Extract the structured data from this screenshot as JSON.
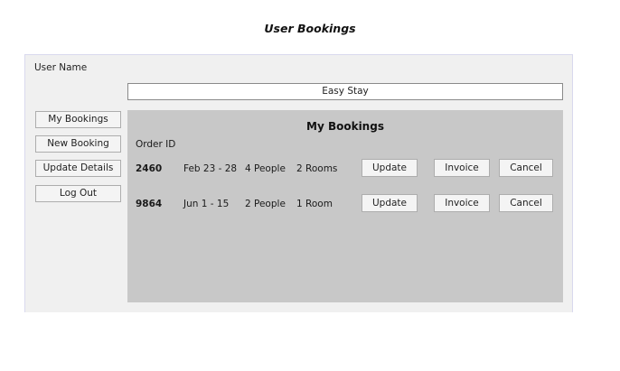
{
  "page": {
    "title": "User Bookings"
  },
  "user": {
    "label": "User Name"
  },
  "hotel": {
    "value": "Easy Stay"
  },
  "nav": {
    "my_bookings": "My Bookings",
    "new_booking": "New Booking",
    "update_details": "Update Details",
    "log_out": "Log Out"
  },
  "panel": {
    "title": "My Bookings",
    "column_header": "Order ID"
  },
  "bookings": [
    {
      "order_id": "2460",
      "dates": "Feb 23 - 28",
      "people": "4 People",
      "rooms": "2 Rooms",
      "update_label": "Update",
      "invoice_label": "Invoice",
      "cancel_label": "Cancel"
    },
    {
      "order_id": "9864",
      "dates": "Jun 1 - 15",
      "people": "2 People",
      "rooms": "1 Room",
      "update_label": "Update",
      "invoice_label": "Invoice",
      "cancel_label": "Cancel"
    }
  ]
}
